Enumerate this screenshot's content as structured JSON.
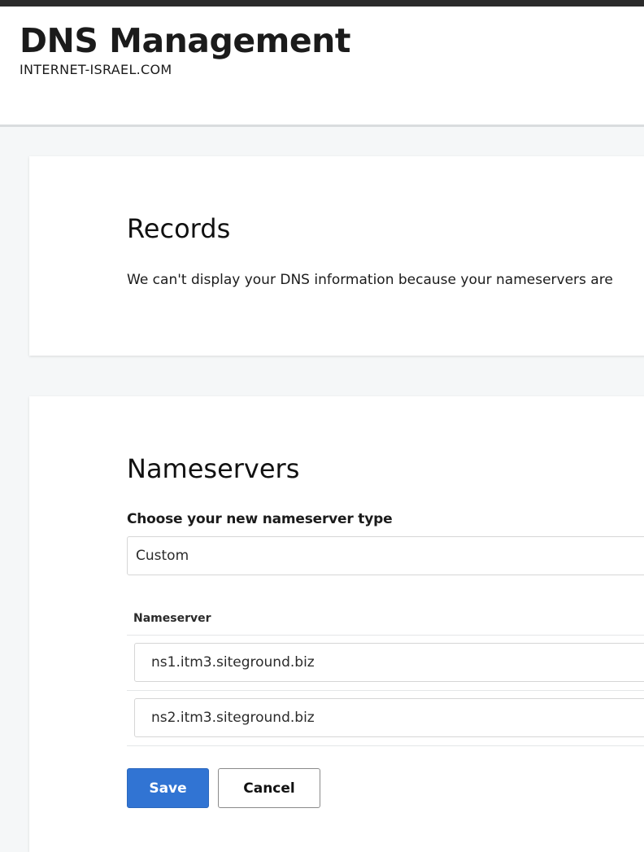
{
  "header": {
    "title": "DNS Management",
    "domain": "INTERNET-ISRAEL.COM"
  },
  "records": {
    "title": "Records",
    "message": "We can't display your DNS information because your nameservers are"
  },
  "nameservers": {
    "title": "Nameservers",
    "type_label": "Choose your new nameserver type",
    "type_value": "Custom",
    "column_header": "Nameserver",
    "entries": [
      "ns1.itm3.siteground.biz",
      "ns2.itm3.siteground.biz"
    ],
    "save_label": "Save",
    "cancel_label": "Cancel"
  },
  "colors": {
    "primary_button": "#3174d3",
    "page_background": "#f5f7f8"
  }
}
